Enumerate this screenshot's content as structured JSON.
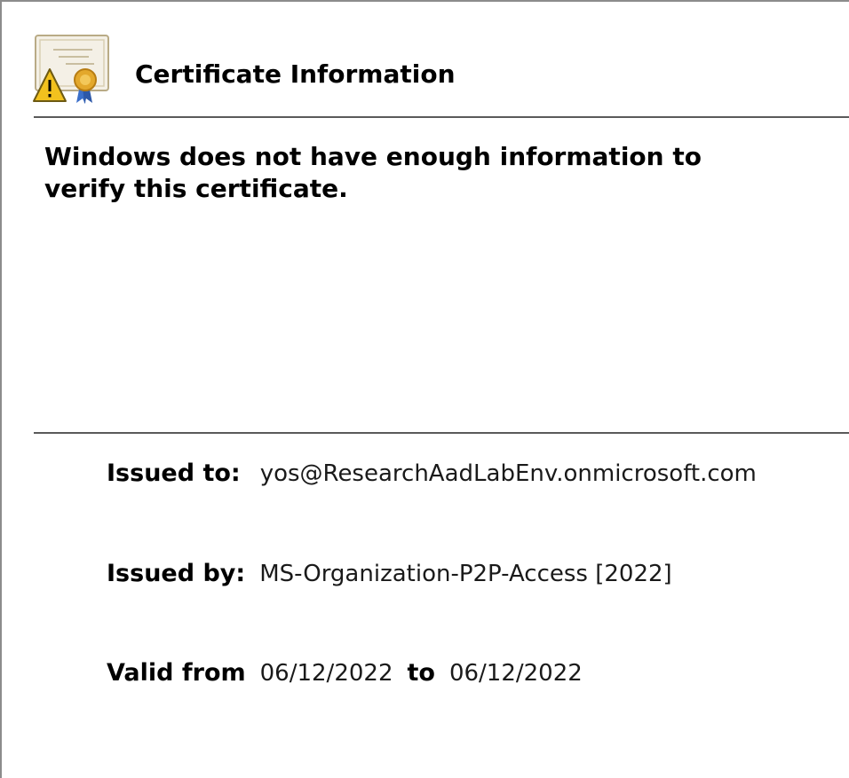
{
  "header": {
    "title": "Certificate Information",
    "icon": "certificate-warning-icon"
  },
  "message": "Windows does not have enough information to verify this certificate.",
  "details": {
    "issued_to_label": "Issued to:",
    "issued_to_value": "yos@ResearchAadLabEnv.onmicrosoft.com",
    "issued_by_label": "Issued by:",
    "issued_by_value": "MS-Organization-P2P-Access [2022]",
    "valid_from_label": "Valid from",
    "valid_from_value": "06/12/2022",
    "valid_to_label": "to",
    "valid_to_value": "06/12/2022"
  },
  "colors": {
    "warning_triangle": "#f2c11e",
    "seal": "#e3a82c",
    "divider": "#5a5a5a"
  }
}
